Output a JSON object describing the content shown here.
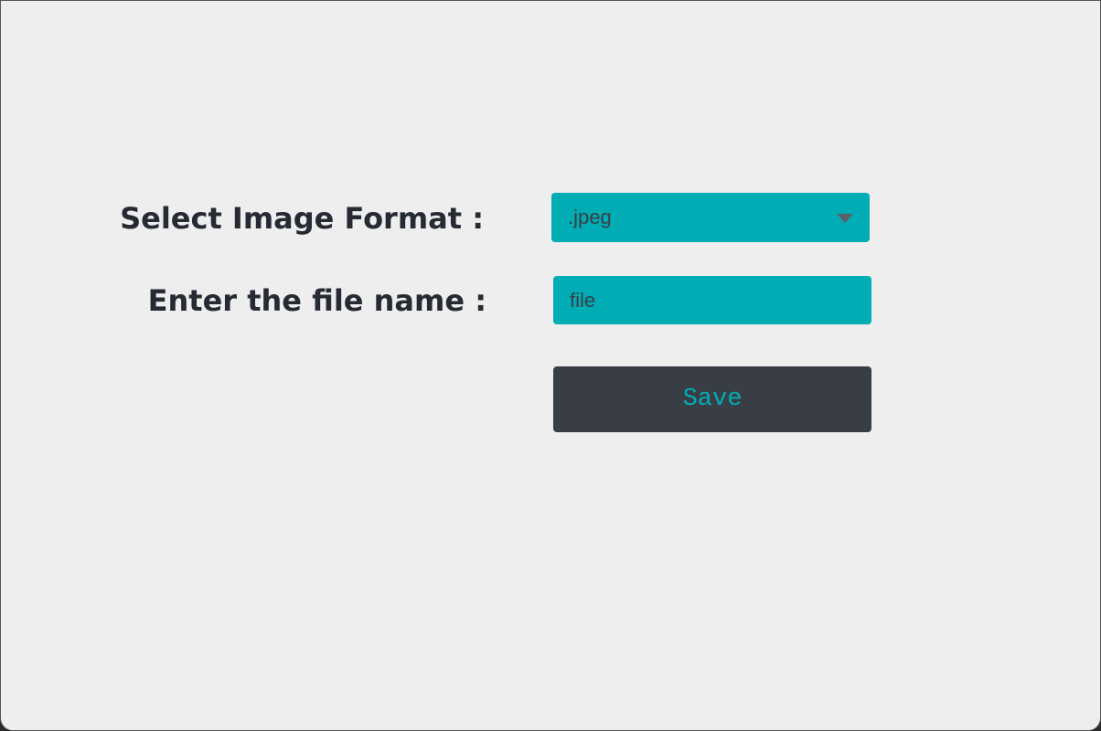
{
  "form": {
    "format_label": "Select Image Format :",
    "format_selected": ".jpeg",
    "filename_label": "Enter the file name :",
    "filename_value": "file",
    "save_label": "Save"
  },
  "colors": {
    "background": "#eeeeee",
    "accent": "#00adb5",
    "dark": "#393e46",
    "label_text": "#262a33"
  },
  "icons": {
    "select_arrow": "chevron-down-icon"
  }
}
